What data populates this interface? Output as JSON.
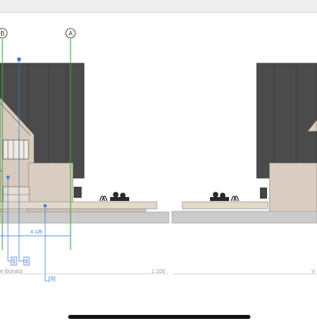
{
  "drawing": {
    "grid_markers": [
      "B",
      "A"
    ],
    "dimension_value": "4.126",
    "callouts": [
      "5",
      "6",
      "7"
    ],
    "sheet_title": "e lõunast",
    "scale": "1:100",
    "sheet_code": "V"
  },
  "colors": {
    "roof": "#4a4a4a",
    "wall": "#d9ccc0",
    "gridline_green": "#3aa53a",
    "marker_blue": "#3c78d8",
    "ground": "#c9c9c9"
  }
}
